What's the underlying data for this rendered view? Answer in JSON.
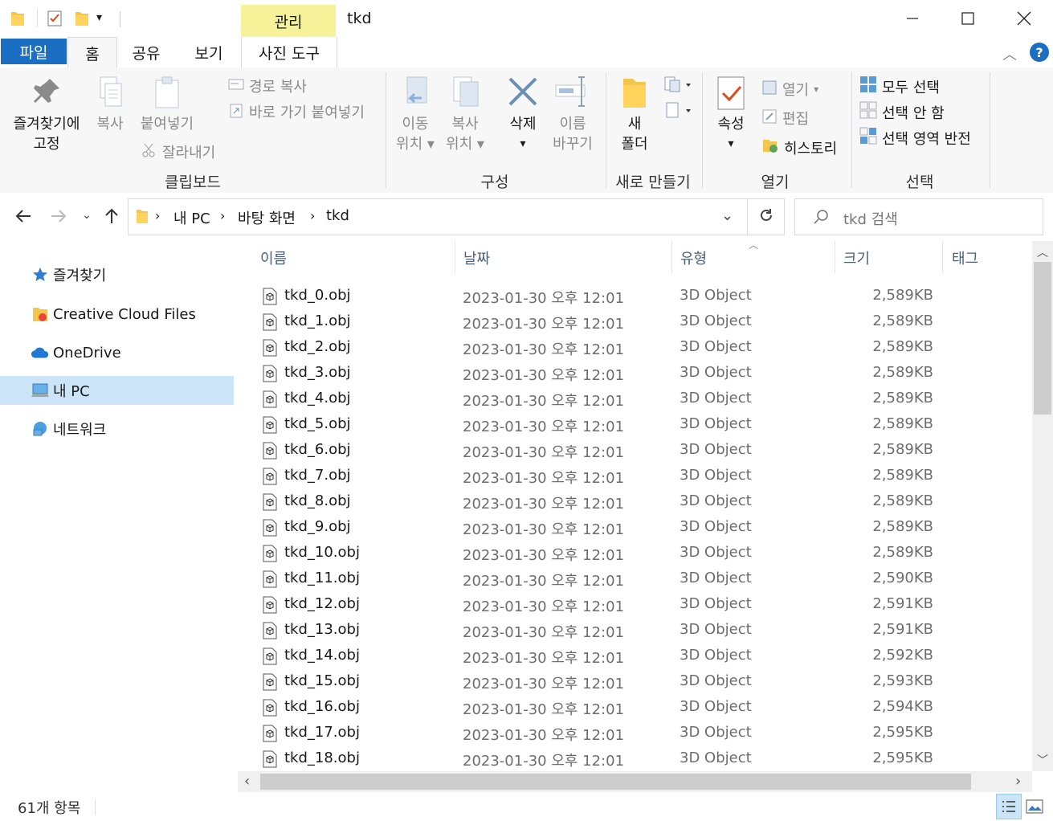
{
  "titlebar": {
    "manage_tab": "관리",
    "window_title": "tkd"
  },
  "tabs": {
    "file": "파일",
    "home": "홈",
    "share": "공유",
    "view": "보기",
    "photo_tools": "사진 도구"
  },
  "ribbon": {
    "clipboard": {
      "pin_line1": "즐겨찾기에",
      "pin_line2": "고정",
      "copy": "복사",
      "paste": "붙여넣기",
      "copy_path": "경로 복사",
      "paste_shortcut": "바로 가기 붙여넣기",
      "cut": "잘라내기",
      "group_label": "클립보드"
    },
    "organize": {
      "move_line1": "이동",
      "move_line2": "위치",
      "copyto_line1": "복사",
      "copyto_line2": "위치",
      "delete": "삭제",
      "rename_line1": "이름",
      "rename_line2": "바꾸기",
      "group_label": "구성"
    },
    "new": {
      "folder_line1": "새",
      "folder_line2": "폴더",
      "group_label": "새로 만들기"
    },
    "open": {
      "properties": "속성",
      "open": "열기",
      "edit": "편집",
      "history": "히스토리",
      "group_label": "열기"
    },
    "select": {
      "select_all": "모두 선택",
      "select_none": "선택 안 함",
      "invert": "선택 영역 반전",
      "group_label": "선택"
    }
  },
  "address": {
    "crumbs": [
      "내 PC",
      "바탕 화면",
      "tkd"
    ],
    "search_placeholder": "tkd 검색"
  },
  "nav": {
    "items": [
      "즐겨찾기",
      "Creative Cloud Files",
      "OneDrive",
      "내 PC",
      "네트워크"
    ]
  },
  "columns": {
    "name": "이름",
    "date": "날짜",
    "type": "유형",
    "size": "크기",
    "tags": "태그"
  },
  "files": [
    {
      "name": "tkd_0.obj",
      "date": "2023-01-30 오후 12:01",
      "type": "3D Object",
      "size": "2,589KB"
    },
    {
      "name": "tkd_1.obj",
      "date": "2023-01-30 오후 12:01",
      "type": "3D Object",
      "size": "2,589KB"
    },
    {
      "name": "tkd_2.obj",
      "date": "2023-01-30 오후 12:01",
      "type": "3D Object",
      "size": "2,589KB"
    },
    {
      "name": "tkd_3.obj",
      "date": "2023-01-30 오후 12:01",
      "type": "3D Object",
      "size": "2,589KB"
    },
    {
      "name": "tkd_4.obj",
      "date": "2023-01-30 오후 12:01",
      "type": "3D Object",
      "size": "2,589KB"
    },
    {
      "name": "tkd_5.obj",
      "date": "2023-01-30 오후 12:01",
      "type": "3D Object",
      "size": "2,589KB"
    },
    {
      "name": "tkd_6.obj",
      "date": "2023-01-30 오후 12:01",
      "type": "3D Object",
      "size": "2,589KB"
    },
    {
      "name": "tkd_7.obj",
      "date": "2023-01-30 오후 12:01",
      "type": "3D Object",
      "size": "2,589KB"
    },
    {
      "name": "tkd_8.obj",
      "date": "2023-01-30 오후 12:01",
      "type": "3D Object",
      "size": "2,589KB"
    },
    {
      "name": "tkd_9.obj",
      "date": "2023-01-30 오후 12:01",
      "type": "3D Object",
      "size": "2,589KB"
    },
    {
      "name": "tkd_10.obj",
      "date": "2023-01-30 오후 12:01",
      "type": "3D Object",
      "size": "2,589KB"
    },
    {
      "name": "tkd_11.obj",
      "date": "2023-01-30 오후 12:01",
      "type": "3D Object",
      "size": "2,590KB"
    },
    {
      "name": "tkd_12.obj",
      "date": "2023-01-30 오후 12:01",
      "type": "3D Object",
      "size": "2,591KB"
    },
    {
      "name": "tkd_13.obj",
      "date": "2023-01-30 오후 12:01",
      "type": "3D Object",
      "size": "2,591KB"
    },
    {
      "name": "tkd_14.obj",
      "date": "2023-01-30 오후 12:01",
      "type": "3D Object",
      "size": "2,592KB"
    },
    {
      "name": "tkd_15.obj",
      "date": "2023-01-30 오후 12:01",
      "type": "3D Object",
      "size": "2,593KB"
    },
    {
      "name": "tkd_16.obj",
      "date": "2023-01-30 오후 12:01",
      "type": "3D Object",
      "size": "2,594KB"
    },
    {
      "name": "tkd_17.obj",
      "date": "2023-01-30 오후 12:01",
      "type": "3D Object",
      "size": "2,595KB"
    },
    {
      "name": "tkd_18.obj",
      "date": "2023-01-30 오후 12:01",
      "type": "3D Object",
      "size": "2,595KB"
    }
  ],
  "status": {
    "item_count": "61개 항목"
  },
  "colors": {
    "accent": "#1a6fc2",
    "manage_tab": "#f5f29a",
    "selected_nav": "#cce4f7"
  }
}
